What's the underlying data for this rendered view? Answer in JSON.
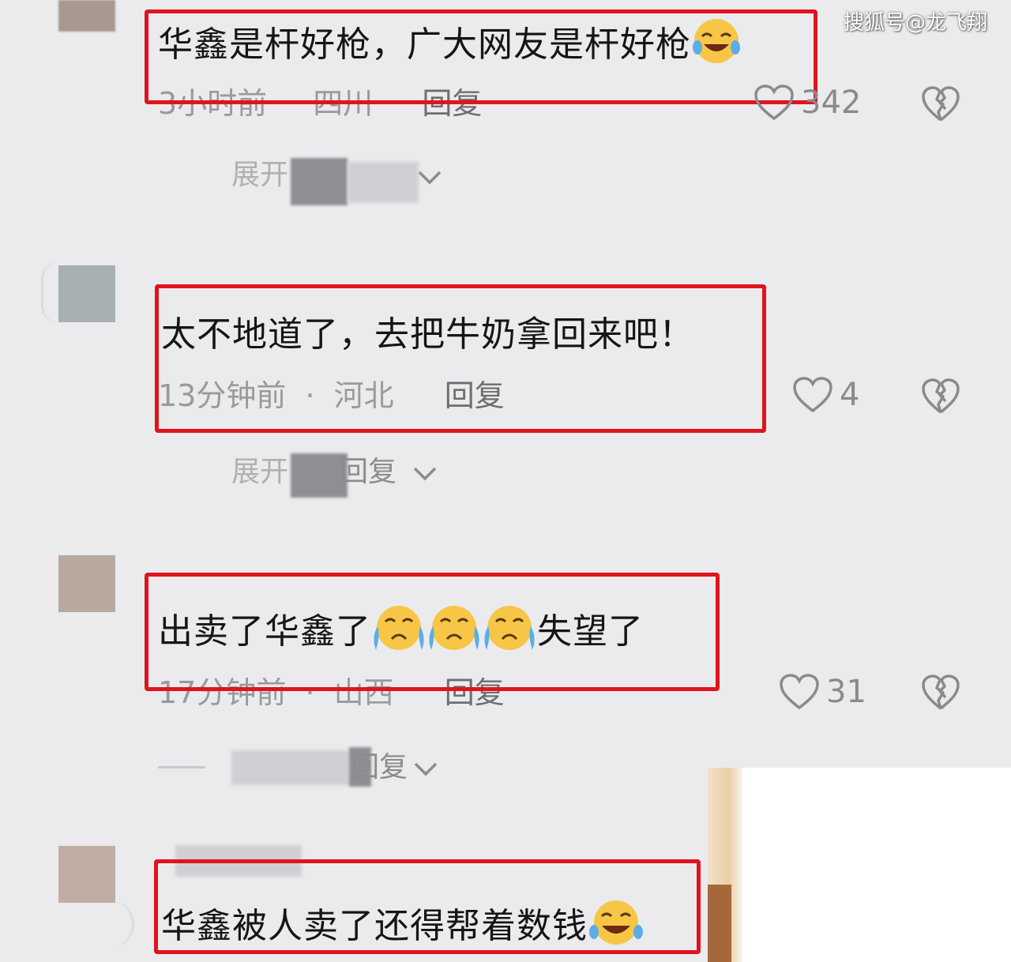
{
  "watermark": "搜狐号@龙飞翔",
  "colors": {
    "background": "#ebebed",
    "highlight_box": "#e0141c",
    "meta_text": "#9a9a9e",
    "icon": "#8a8a8e"
  },
  "comments": [
    {
      "text": "华鑫是杆好枪，广大网友是杆好枪",
      "emoji": "laughing-tears-emoji",
      "time": "3小时前",
      "location": "四川",
      "reply_label": "回复",
      "likes": "342",
      "expand_label": "展开",
      "expand_icon": "chevron-down-icon"
    },
    {
      "text": "太不地道了，去把牛奶拿回来吧！",
      "time": "13分钟前",
      "separator": "·",
      "location": "河北",
      "reply_label": "回复",
      "likes": "4",
      "expand_label_prefix": "展开",
      "expand_label_suffix": "回复",
      "expand_icon": "chevron-down-icon"
    },
    {
      "text_before": "出卖了华鑫了",
      "emoji": "crying-emoji",
      "emoji_count": 3,
      "text_after": "失望了",
      "time": "17分钟前",
      "separator": "·",
      "location": "山西",
      "reply_label": "回复",
      "likes": "31",
      "expand_label": "回复",
      "expand_icon": "chevron-down-icon"
    },
    {
      "text": "华鑫被人卖了还得帮着数钱",
      "emoji": "laughing-tears-emoji"
    }
  ],
  "icons": {
    "like": "heart-outline-icon",
    "dislike": "broken-heart-icon"
  }
}
